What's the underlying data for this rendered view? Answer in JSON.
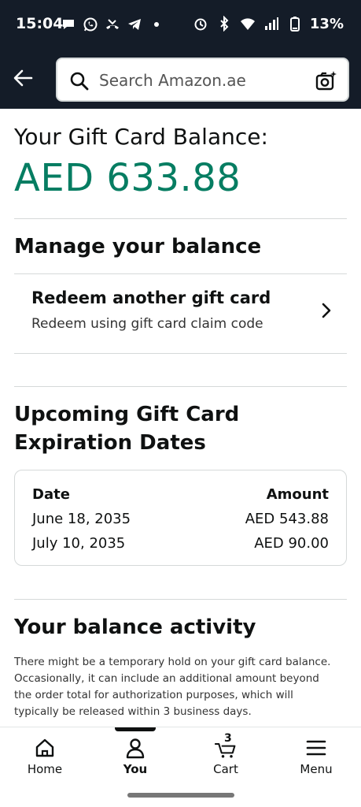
{
  "status_bar": {
    "time": "15:04",
    "battery_percent": "13%",
    "left_icons": [
      "chat-bubble-icon",
      "whatsapp-icon",
      "missed-call-icon",
      "telegram-icon",
      "dot-icon"
    ],
    "right_icons": [
      "alarm-icon",
      "bluetooth-icon",
      "wifi-icon",
      "signal-icon",
      "battery-icon"
    ]
  },
  "header": {
    "search_placeholder": "Search Amazon.ae"
  },
  "balance": {
    "title": "Your Gift Card Balance:",
    "amount": "AED 633.88"
  },
  "manage": {
    "title": "Manage your balance",
    "redeem_title": "Redeem another gift card",
    "redeem_subtitle": "Redeem using gift card claim code"
  },
  "expiration": {
    "title": "Upcoming Gift Card Expiration Dates",
    "headers": {
      "date": "Date",
      "amount": "Amount"
    },
    "rows": [
      {
        "date": "June 18, 2035",
        "amount": "AED 543.88"
      },
      {
        "date": "July 10, 2035",
        "amount": "AED 90.00"
      }
    ]
  },
  "activity": {
    "title": "Your balance activity",
    "note": "There might be a temporary hold on your gift card balance. Occasionally, it can include an additional amount beyond the order total for authorization purposes, which will typically be released within 3 business days."
  },
  "bottom_nav": {
    "items": [
      {
        "label": "Home",
        "icon": "home-icon"
      },
      {
        "label": "You",
        "icon": "person-icon",
        "active": true
      },
      {
        "label": "Cart",
        "icon": "cart-icon",
        "count": "3"
      },
      {
        "label": "Menu",
        "icon": "menu-icon"
      }
    ]
  },
  "colors": {
    "header_bg": "#141c28",
    "balance_green": "#067d62",
    "divider": "#d5d9d9"
  }
}
